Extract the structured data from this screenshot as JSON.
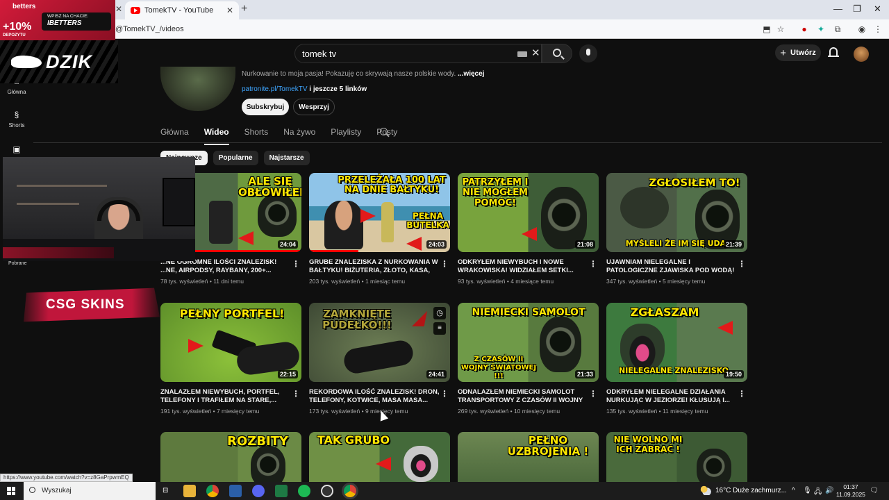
{
  "browser": {
    "tab_title": "TomekTV - YouTube",
    "url": "@TomekTV_/videos",
    "new_tab": "+",
    "close": "✕"
  },
  "search": {
    "query": "tomek tv"
  },
  "header": {
    "create_label": "Utwórz"
  },
  "sidebar": {
    "items": [
      {
        "label": "Główna",
        "icon": "home-icon"
      },
      {
        "label": "Shorts",
        "icon": "shorts-icon"
      },
      {
        "label": "Subskrypcje",
        "icon": "subscriptions-icon"
      }
    ]
  },
  "channel": {
    "description": "Nurkowanie to moja pasja! Pokazuję co skrywają nasze polskie wody.",
    "more": "...więcej",
    "link": "patronite.pl/TomekTV",
    "more_links": "i jeszcze 5 linków",
    "subscribe": "Subskrybuj",
    "support": "Wesprzyj"
  },
  "tabs": [
    "Główna",
    "Wideo",
    "Shorts",
    "Na żywo",
    "Playlisty",
    "Posty"
  ],
  "active_tab": "Wideo",
  "chips": [
    "Najnowsze",
    "Popularne",
    "Najstarsze"
  ],
  "videos": [
    {
      "thumb_text": "ALE SIĘ OBŁOWIŁEM!",
      "duration": "24:04",
      "title": "...NE OGROMNE ILOŚCI ZNALEZISK! ...NE, AIRPODSY, RAYBANY, 200+...",
      "views": "78 tys. wyświetleń",
      "age": "11 dni temu",
      "progress": 1.0
    },
    {
      "thumb_text": "PRZELEŻAŁA 100 LAT NA DNIE BAŁTYKU!",
      "thumb_text2": "PEŁNA BUTELKA",
      "duration": "24:03",
      "title": "GRUBE ZNALEZISKA Z NURKOWANIA W BAŁTYKU! BIŻUTERIA, ZŁOTO, KASA, 100-...",
      "views": "203 tys. wyświetleń",
      "age": "1 miesiąc temu",
      "progress": 0.35
    },
    {
      "thumb_text": "PATRZYŁEM I NIE MOGŁEM POMÓC!",
      "duration": "21:08",
      "title": "ODKRYŁEM NIEWYBUCH I NOWE WRAKOWISKA! WIDZIAŁEM SETKI...",
      "views": "93 tys. wyświetleń",
      "age": "4 miesiące temu",
      "progress": 0
    },
    {
      "thumb_text": "ZGŁOSIŁEM TO!",
      "thumb_text2": "MYŚLELI ŻE IM SIĘ UDA",
      "duration": "21:39",
      "title": "UJAWNIAM NIELEGALNE I PATOLOGICZNE ZJAWISKA POD WODĄ! KŁUSOWNICTWO I...",
      "views": "347 tys. wyświetleń",
      "age": "5 miesięcy temu",
      "progress": 0
    },
    {
      "thumb_text": "PEŁNY PORTFEL!",
      "duration": "22:15",
      "title": "ZNALAZŁEM NIEWYBUCH, PORTFEL, TELEFONY I TRAFIŁEM NA STARE,...",
      "views": "191 tys. wyświetleń",
      "age": "7 miesięcy temu",
      "progress": 0
    },
    {
      "thumb_text": "ZAMKNIĘTE PUDEŁKO!!!",
      "duration": "24:41",
      "title": "REKORDOWA ILOŚĆ ZNALEZISK! DRON, TELEFONY, KOTWICE, MASA MASA...",
      "views": "173 tys. wyświetleń",
      "age": "9 miesięcy temu",
      "progress": 0
    },
    {
      "thumb_text": "NIEMIECKI SAMOLOT",
      "thumb_text2": "Z CZASÓW II WOJNY ŚWIATOWEJ !!!",
      "duration": "21:33",
      "title": "ODNALAZŁEM NIEMIECKI SAMOLOT TRANSPORTOWY Z CZASÓW II WOJNY !!!...",
      "views": "269 tys. wyświetleń",
      "age": "10 miesięcy temu",
      "progress": 0
    },
    {
      "thumb_text": "ZGŁASZAM",
      "thumb_text2": "NIELEGALNE ZNALEZISKO",
      "duration": "19:50",
      "title": "ODKRYŁEM NIELEGALNE DZIAŁANIA NURKUJĄC W JEZIORZE! KŁUSUJĄ I...",
      "views": "135 tys. wyświetleń",
      "age": "11 miesięcy temu",
      "progress": 0
    },
    {
      "thumb_text": "ROZBITY"
    },
    {
      "thumb_text": "TAK GRUBO"
    },
    {
      "thumb_text": "PEŁNO UZBROJENIA !"
    },
    {
      "thumb_text": "NIE WOLNO MI ICH ZABRAĆ !"
    }
  ],
  "overlays": {
    "betters_logo": "betters",
    "betters_promo1": "WPISZ NA CHACIE:",
    "betters_promo2": "IBETTERS",
    "betters_pct": "+10%",
    "betters_pct_sub": "DEPOZYTU",
    "dzik": "DZIK",
    "csgo": "CSG SKINS",
    "side_label": "Pobrane"
  },
  "status_url": "https://www.youtube.com/watch?v=z8GaPrpwmEQ",
  "taskbar": {
    "search_placeholder": "Wyszukaj",
    "weather": "16°C  Duże zachmurz...",
    "time": "01:37",
    "date": "11.09.2025"
  },
  "colors": {
    "accent": "#ff0000",
    "link": "#3ea6ff",
    "thumb_text": "#ffe800"
  }
}
